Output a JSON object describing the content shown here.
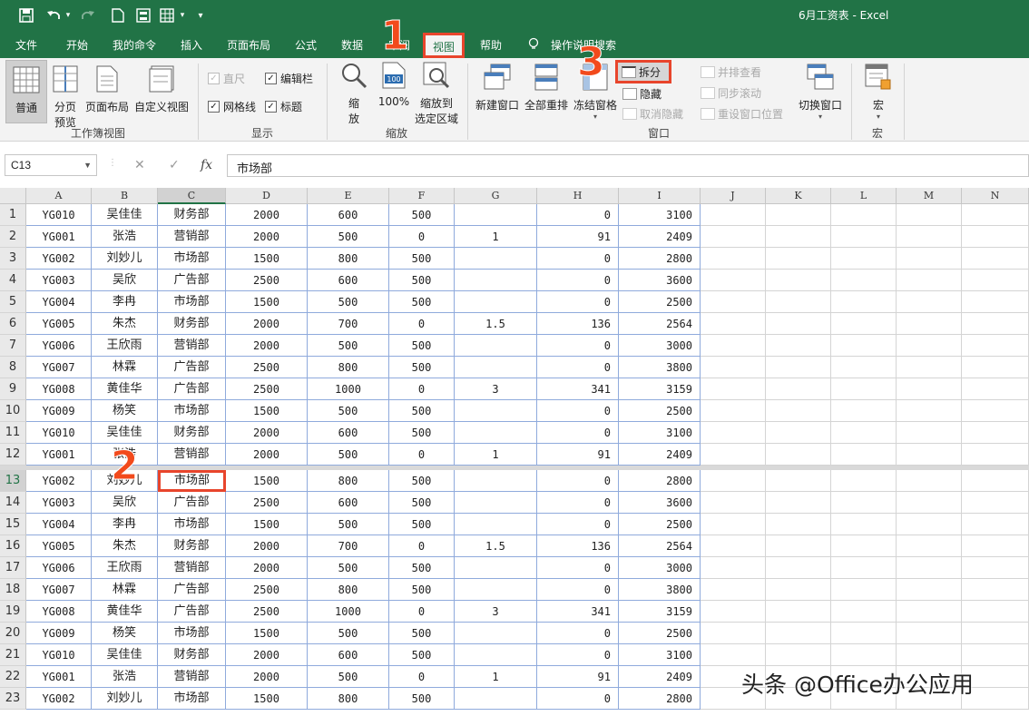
{
  "window": {
    "title": "6月工资表  -  Excel"
  },
  "quick_access": {
    "save": "save-icon",
    "undo": "undo-icon",
    "redo": "redo-icon",
    "new": "new-file-icon",
    "print": "print-preview-icon",
    "form": "form-icon",
    "more": "customize-icon"
  },
  "menu": {
    "tabs": [
      "文件",
      "开始",
      "我的命令",
      "插入",
      "页面布局",
      "公式",
      "数据",
      "审阅",
      "视图",
      "帮助"
    ],
    "active_index": 8,
    "search": "操作说明搜索"
  },
  "ribbon": {
    "workbook_views": {
      "normal": "普通",
      "page_break_1": "分页",
      "page_break_2": "预览",
      "page_layout": "页面布局",
      "custom_views": "自定义视图",
      "group_label": "工作簿视图"
    },
    "show": {
      "ruler": "直尺",
      "formula_bar": "编辑栏",
      "gridlines": "网格线",
      "headings": "标题",
      "group_label": "显示"
    },
    "zoom": {
      "zoom_1": "缩",
      "zoom_2": "放",
      "zoom_100": "100%",
      "zoom_selection_1": "缩放到",
      "zoom_selection_2": "选定区域",
      "group_label": "缩放"
    },
    "window": {
      "new_window": "新建窗口",
      "arrange_all": "全部重排",
      "freeze_panes": "冻结窗格",
      "split": "拆分",
      "hide": "隐藏",
      "unhide": "取消隐藏",
      "side_by_side": "并排查看",
      "sync_scroll": "同步滚动",
      "reset_position": "重设窗口位置",
      "switch_windows": "切换窗口",
      "group_label": "窗口"
    },
    "macros": {
      "macros": "宏",
      "group_label": "宏"
    }
  },
  "formula_bar": {
    "name_box": "C13",
    "cancel": "✕",
    "enter": "✓",
    "fx": "fx",
    "value": "市场部"
  },
  "columns": [
    "A",
    "B",
    "C",
    "D",
    "E",
    "F",
    "G",
    "H",
    "I",
    "J",
    "K",
    "L",
    "M",
    "N"
  ],
  "rows": [
    {
      "n": "1",
      "a": "YG010",
      "b": "吴佳佳",
      "c": "财务部",
      "d": "2000",
      "e": "600",
      "f": "500",
      "g": "",
      "h": "0",
      "i": "3100"
    },
    {
      "n": "2",
      "a": "YG001",
      "b": "张浩",
      "c": "营销部",
      "d": "2000",
      "e": "500",
      "f": "0",
      "g": "1",
      "h": "91",
      "i": "2409"
    },
    {
      "n": "3",
      "a": "YG002",
      "b": "刘妙儿",
      "c": "市场部",
      "d": "1500",
      "e": "800",
      "f": "500",
      "g": "",
      "h": "0",
      "i": "2800"
    },
    {
      "n": "4",
      "a": "YG003",
      "b": "吴欣",
      "c": "广告部",
      "d": "2500",
      "e": "600",
      "f": "500",
      "g": "",
      "h": "0",
      "i": "3600"
    },
    {
      "n": "5",
      "a": "YG004",
      "b": "李冉",
      "c": "市场部",
      "d": "1500",
      "e": "500",
      "f": "500",
      "g": "",
      "h": "0",
      "i": "2500"
    },
    {
      "n": "6",
      "a": "YG005",
      "b": "朱杰",
      "c": "财务部",
      "d": "2000",
      "e": "700",
      "f": "0",
      "g": "1.5",
      "h": "136",
      "i": "2564"
    },
    {
      "n": "7",
      "a": "YG006",
      "b": "王欣雨",
      "c": "营销部",
      "d": "2000",
      "e": "500",
      "f": "500",
      "g": "",
      "h": "0",
      "i": "3000"
    },
    {
      "n": "8",
      "a": "YG007",
      "b": "林霖",
      "c": "广告部",
      "d": "2500",
      "e": "800",
      "f": "500",
      "g": "",
      "h": "0",
      "i": "3800"
    },
    {
      "n": "9",
      "a": "YG008",
      "b": "黄佳华",
      "c": "广告部",
      "d": "2500",
      "e": "1000",
      "f": "0",
      "g": "3",
      "h": "341",
      "i": "3159"
    },
    {
      "n": "10",
      "a": "YG009",
      "b": "杨笑",
      "c": "市场部",
      "d": "1500",
      "e": "500",
      "f": "500",
      "g": "",
      "h": "0",
      "i": "2500"
    },
    {
      "n": "11",
      "a": "YG010",
      "b": "吴佳佳",
      "c": "财务部",
      "d": "2000",
      "e": "600",
      "f": "500",
      "g": "",
      "h": "0",
      "i": "3100"
    },
    {
      "n": "12",
      "a": "YG001",
      "b": "张浩",
      "c": "营销部",
      "d": "2000",
      "e": "500",
      "f": "0",
      "g": "1",
      "h": "91",
      "i": "2409"
    },
    {
      "n": "13",
      "a": "YG002",
      "b": "刘妙儿",
      "c": "市场部",
      "d": "1500",
      "e": "800",
      "f": "500",
      "g": "",
      "h": "0",
      "i": "2800"
    },
    {
      "n": "14",
      "a": "YG003",
      "b": "吴欣",
      "c": "广告部",
      "d": "2500",
      "e": "600",
      "f": "500",
      "g": "",
      "h": "0",
      "i": "3600"
    },
    {
      "n": "15",
      "a": "YG004",
      "b": "李冉",
      "c": "市场部",
      "d": "1500",
      "e": "500",
      "f": "500",
      "g": "",
      "h": "0",
      "i": "2500"
    },
    {
      "n": "16",
      "a": "YG005",
      "b": "朱杰",
      "c": "财务部",
      "d": "2000",
      "e": "700",
      "f": "0",
      "g": "1.5",
      "h": "136",
      "i": "2564"
    },
    {
      "n": "17",
      "a": "YG006",
      "b": "王欣雨",
      "c": "营销部",
      "d": "2000",
      "e": "500",
      "f": "500",
      "g": "",
      "h": "0",
      "i": "3000"
    },
    {
      "n": "18",
      "a": "YG007",
      "b": "林霖",
      "c": "广告部",
      "d": "2500",
      "e": "800",
      "f": "500",
      "g": "",
      "h": "0",
      "i": "3800"
    },
    {
      "n": "19",
      "a": "YG008",
      "b": "黄佳华",
      "c": "广告部",
      "d": "2500",
      "e": "1000",
      "f": "0",
      "g": "3",
      "h": "341",
      "i": "3159"
    },
    {
      "n": "20",
      "a": "YG009",
      "b": "杨笑",
      "c": "市场部",
      "d": "1500",
      "e": "500",
      "f": "500",
      "g": "",
      "h": "0",
      "i": "2500"
    },
    {
      "n": "21",
      "a": "YG010",
      "b": "吴佳佳",
      "c": "财务部",
      "d": "2000",
      "e": "600",
      "f": "500",
      "g": "",
      "h": "0",
      "i": "3100"
    },
    {
      "n": "22",
      "a": "YG001",
      "b": "张浩",
      "c": "营销部",
      "d": "2000",
      "e": "500",
      "f": "0",
      "g": "1",
      "h": "91",
      "i": "2409"
    },
    {
      "n": "23",
      "a": "YG002",
      "b": "刘妙儿",
      "c": "市场部",
      "d": "1500",
      "e": "800",
      "f": "500",
      "g": "",
      "h": "0",
      "i": "2800"
    }
  ],
  "selected_cell": "C13",
  "annotations": [
    "1",
    "2",
    "3"
  ],
  "watermark": "头条 @Office办公应用",
  "colors": {
    "title_bar": "#217346",
    "annotation": "#f24a1c",
    "data_border": "#8faadc"
  }
}
